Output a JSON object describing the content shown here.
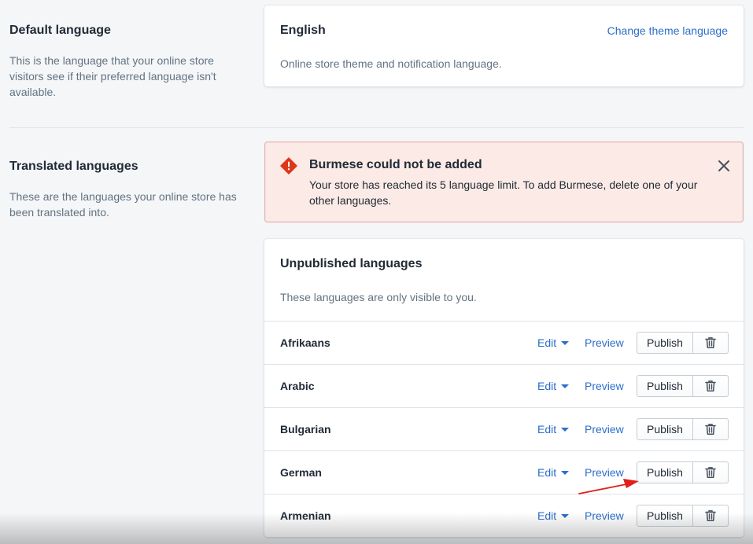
{
  "default_language": {
    "section_title": "Default language",
    "section_desc": "This is the language that your online store visitors see if their preferred language isn't available.",
    "card_title": "English",
    "change_link": "Change theme language",
    "card_sub": "Online store theme and notification language."
  },
  "translated_languages": {
    "section_title": "Translated languages",
    "section_desc": "These are the languages your online store has been translated into."
  },
  "error_banner": {
    "title": "Burmese could not be added",
    "body": "Your store has reached its 5 language limit. To add Burmese, delete one of your other languages.",
    "icon": "alert-diamond-icon",
    "close_icon": "close-icon",
    "color": "#de3618"
  },
  "unpublished": {
    "title": "Unpublished languages",
    "subtitle": "These languages are only visible to you.",
    "edit_label": "Edit",
    "preview_label": "Preview",
    "publish_label": "Publish",
    "delete_icon": "trash-icon",
    "languages": [
      "Afrikaans",
      "Arabic",
      "Bulgarian",
      "German",
      "Armenian"
    ]
  },
  "annotation": {
    "arrow_color": "#e0201a"
  }
}
